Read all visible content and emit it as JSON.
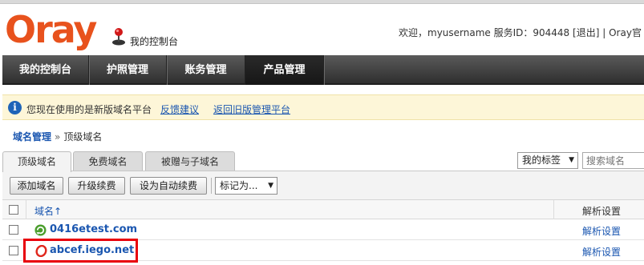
{
  "header": {
    "logo_text": "Oray",
    "console_label": "我的控制台",
    "welcome_text": "欢迎，myusername 服务ID：904448",
    "logout_label": "[退出]",
    "separator": "|",
    "truncated_link": "Oray官"
  },
  "nav": {
    "items": [
      {
        "label": "我的控制台"
      },
      {
        "label": "护照管理"
      },
      {
        "label": "账务管理"
      },
      {
        "label": "产品管理",
        "active": true
      }
    ]
  },
  "notice": {
    "text": "您现在使用的是新版域名平台",
    "feedback_link": "反馈建议",
    "old_version_link": "返回旧版管理平台"
  },
  "breadcrumb": {
    "parent": "域名管理",
    "separator": "»",
    "current": "顶级域名"
  },
  "tabs": [
    {
      "label": "顶级域名",
      "active": true
    },
    {
      "label": "免费域名"
    },
    {
      "label": "被赠与子域名"
    }
  ],
  "filters": {
    "tag_select": "我的标签",
    "search_placeholder": "搜索域名"
  },
  "toolbar": {
    "add_domain": "添加域名",
    "upgrade_renew": "升级续费",
    "set_auto_renew": "设为自动续费",
    "mark_as": "标记为..."
  },
  "table": {
    "headers": {
      "domain": "域名↑",
      "dns": "解析设置"
    },
    "rows": [
      {
        "domain": "0416etest.com",
        "dns": "解析设置",
        "icon": "green-refresh-icon"
      },
      {
        "domain": "abcef.iego.net",
        "dns": "解析设置",
        "icon": "red-o-icon",
        "highlighted": true
      }
    ]
  },
  "colors": {
    "brand_orange": "#e8521d",
    "link_blue": "#1a56b0",
    "nav_dark": "#2f2f2f",
    "notice_bg": "#fdf6d8",
    "highlight_red": "#e8000b"
  }
}
